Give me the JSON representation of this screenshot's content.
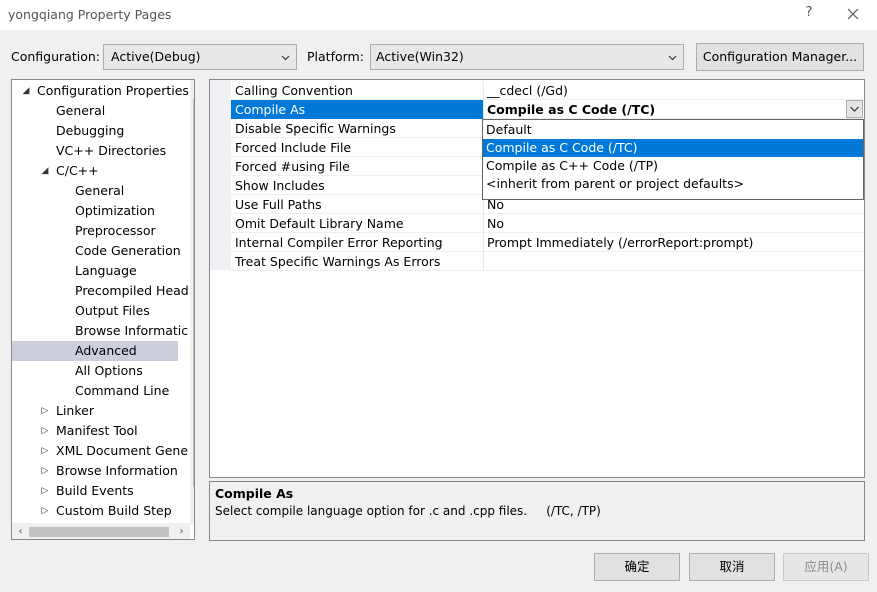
{
  "window": {
    "title": "yongqiang Property Pages",
    "help": "?"
  },
  "config": {
    "configuration_label": "Configuration:",
    "configuration_value": "Active(Debug)",
    "platform_label": "Platform:",
    "platform_value": "Active(Win32)",
    "manager_label": "Configuration Manager..."
  },
  "tree": {
    "items": [
      {
        "label": "Configuration Properties",
        "expander": "◢"
      },
      {
        "label": "General"
      },
      {
        "label": "Debugging"
      },
      {
        "label": "VC++ Directories"
      },
      {
        "label": "C/C++",
        "expander": "◢"
      },
      {
        "label": "General"
      },
      {
        "label": "Optimization"
      },
      {
        "label": "Preprocessor"
      },
      {
        "label": "Code Generation"
      },
      {
        "label": "Language"
      },
      {
        "label": "Precompiled Head"
      },
      {
        "label": "Output Files"
      },
      {
        "label": "Browse Informatic"
      },
      {
        "label": "Advanced",
        "selected": true
      },
      {
        "label": "All Options"
      },
      {
        "label": "Command Line"
      },
      {
        "label": "Linker",
        "expander": "▷"
      },
      {
        "label": "Manifest Tool",
        "expander": "▷"
      },
      {
        "label": "XML Document Gene",
        "expander": "▷"
      },
      {
        "label": "Browse Information",
        "expander": "▷"
      },
      {
        "label": "Build Events",
        "expander": "▷"
      },
      {
        "label": "Custom Build Step",
        "expander": "▷"
      }
    ]
  },
  "grid": {
    "rows": [
      {
        "name": "Calling Convention",
        "value": "__cdecl (/Gd)"
      },
      {
        "name": "Compile As",
        "value": "Compile as C Code (/TC)"
      },
      {
        "name": "Disable Specific Warnings",
        "value": ""
      },
      {
        "name": "Forced Include File",
        "value": ""
      },
      {
        "name": "Forced #using File",
        "value": ""
      },
      {
        "name": "Show Includes",
        "value": ""
      },
      {
        "name": "Use Full Paths",
        "value": "No"
      },
      {
        "name": "Omit Default Library Name",
        "value": "No"
      },
      {
        "name": "Internal Compiler Error Reporting",
        "value": "Prompt Immediately (/errorReport:prompt)"
      },
      {
        "name": "Treat Specific Warnings As Errors",
        "value": ""
      }
    ],
    "dropdown_options": [
      "Default",
      "Compile as C Code (/TC)",
      "Compile as C++ Code (/TP)",
      "<inherit from parent or project defaults>"
    ]
  },
  "description": {
    "title": "Compile As",
    "text": "Select compile language option for .c and .cpp files.     (/TC, /TP)"
  },
  "buttons": {
    "ok": "确定",
    "cancel": "取消",
    "apply": "应用(A)"
  },
  "colors": {
    "selection": "#0078d7",
    "tree_selection": "#cccedb"
  }
}
